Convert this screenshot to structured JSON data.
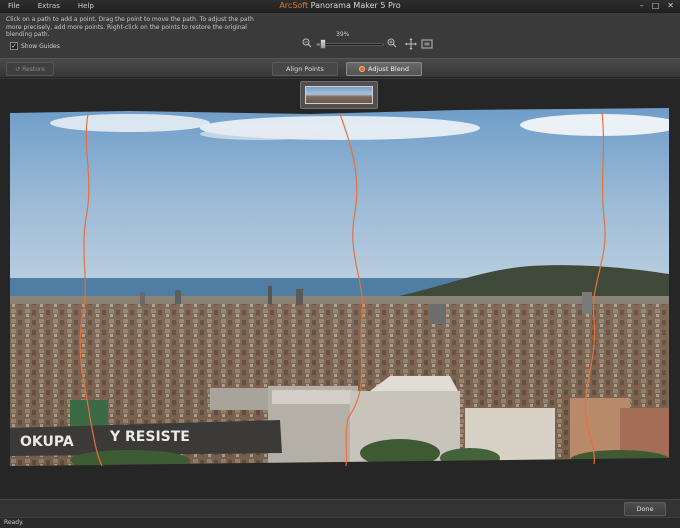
{
  "app": {
    "brand": "ArcSoft",
    "title": "Panorama Maker 5 Pro"
  },
  "menu": [
    {
      "label": "File"
    },
    {
      "label": "Extras"
    },
    {
      "label": "Help"
    }
  ],
  "window_controls": {
    "minimize": "–",
    "maximize": "□",
    "close": "✕"
  },
  "instructions": "Click on a path to add a point. Drag the point to move the path. To adjust the path more precisely, add more points. Right-click on the points to restore the original blending path.",
  "guides": {
    "label": "Show Guides",
    "checked": true
  },
  "zoom": {
    "percent_label": "39%",
    "value": 0.1
  },
  "toolbar": {
    "restore_label": "Restore",
    "tab_align": "Align Points",
    "tab_blend": "Adjust Blend"
  },
  "panorama": {
    "ground_text_1": "OKUPA",
    "ground_text_2": "Y RESISTE",
    "accent_path_color": "#e8703a"
  },
  "footer": {
    "done_label": "Done",
    "status": "Ready."
  }
}
